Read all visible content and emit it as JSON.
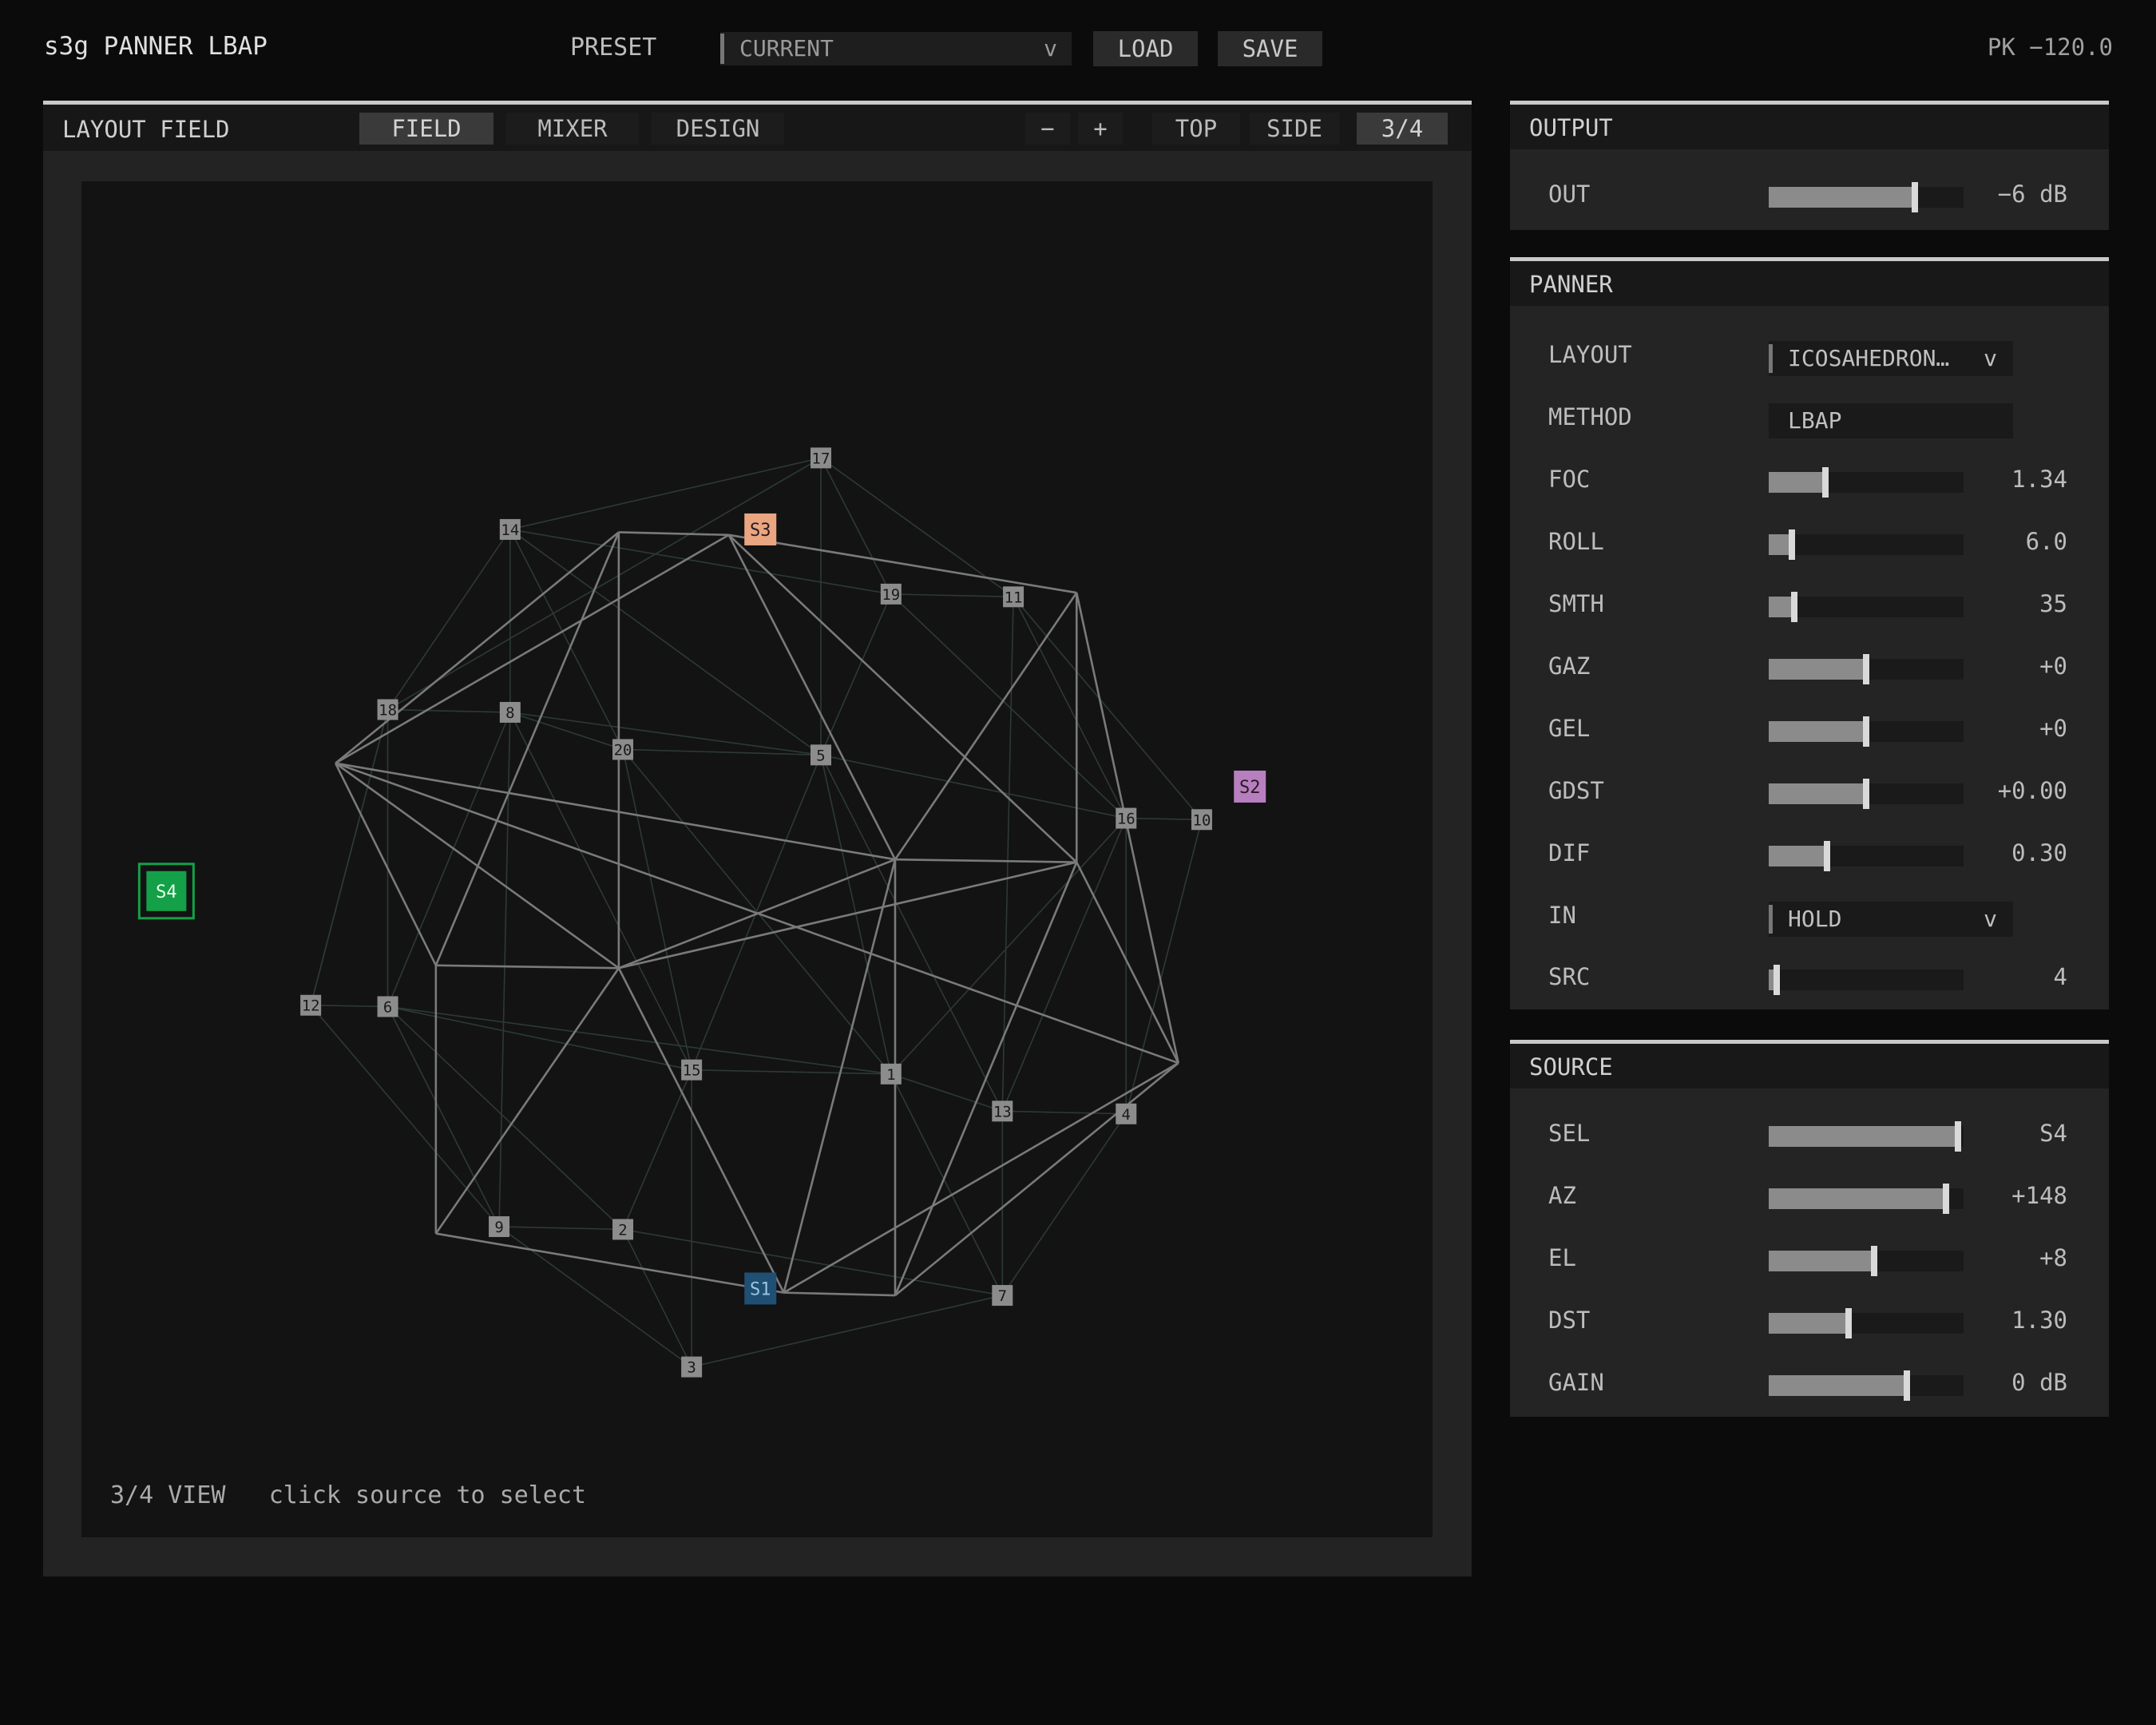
{
  "header": {
    "title": "s3g PANNER LBAP",
    "preset_label": "PRESET",
    "preset_value": "CURRENT",
    "load_label": "LOAD",
    "save_label": "SAVE",
    "peak": "PK −120.0"
  },
  "field_panel": {
    "title": "LAYOUT FIELD",
    "tabs": [
      "FIELD",
      "MIXER",
      "DESIGN"
    ],
    "active_tab": "FIELD",
    "view_buttons": [
      "−",
      "+",
      "TOP",
      "SIDE",
      "3/4"
    ],
    "active_view": "3/4",
    "hint_view": "3/4 VIEW",
    "hint_text": "click source to select"
  },
  "field": {
    "speakers": [
      "1",
      "2",
      "3",
      "4",
      "5",
      "6",
      "7",
      "8",
      "9",
      "10",
      "11",
      "12",
      "13",
      "14",
      "15",
      "16",
      "17",
      "18",
      "19",
      "20"
    ],
    "sources": [
      {
        "label": "S1",
        "color": "#1f4f73",
        "selected": false
      },
      {
        "label": "S2",
        "color": "#b77fc0",
        "selected": false
      },
      {
        "label": "S3",
        "color": "#e9a681",
        "selected": false
      },
      {
        "label": "S4",
        "color": "#14a048",
        "selected": true
      }
    ]
  },
  "output": {
    "title": "OUTPUT",
    "rows": [
      {
        "label": "OUT",
        "value": "−6 dB",
        "level": 0.75
      }
    ]
  },
  "panner": {
    "title": "PANNER",
    "layout_label": "LAYOUT",
    "layout_value": "ICOSAHEDRON…",
    "method_label": "METHOD",
    "method_value": "LBAP",
    "sliders": [
      {
        "label": "FOC",
        "value": "1.34",
        "level": 0.29
      },
      {
        "label": "ROLL",
        "value": "6.0",
        "level": 0.12
      },
      {
        "label": "SMTH",
        "value": "35",
        "level": 0.13
      },
      {
        "label": "GAZ",
        "value": "+0",
        "level": 0.5
      },
      {
        "label": "GEL",
        "value": "+0",
        "level": 0.5
      },
      {
        "label": "GDST",
        "value": "+0.00",
        "level": 0.5
      },
      {
        "label": "DIF",
        "value": "0.30",
        "level": 0.3
      }
    ],
    "in_label": "IN",
    "in_value": "HOLD",
    "src_label": "SRC",
    "src_value": "4",
    "src_level": 0.04
  },
  "source": {
    "title": "SOURCE",
    "rows": [
      {
        "label": "SEL",
        "value": "S4",
        "level": 0.97
      },
      {
        "label": "AZ",
        "value": "+148",
        "level": 0.91
      },
      {
        "label": "EL",
        "value": "+8",
        "level": 0.54
      },
      {
        "label": "DST",
        "value": "1.30",
        "level": 0.41
      },
      {
        "label": "GAIN",
        "value": "0 dB",
        "level": 0.71
      }
    ]
  }
}
